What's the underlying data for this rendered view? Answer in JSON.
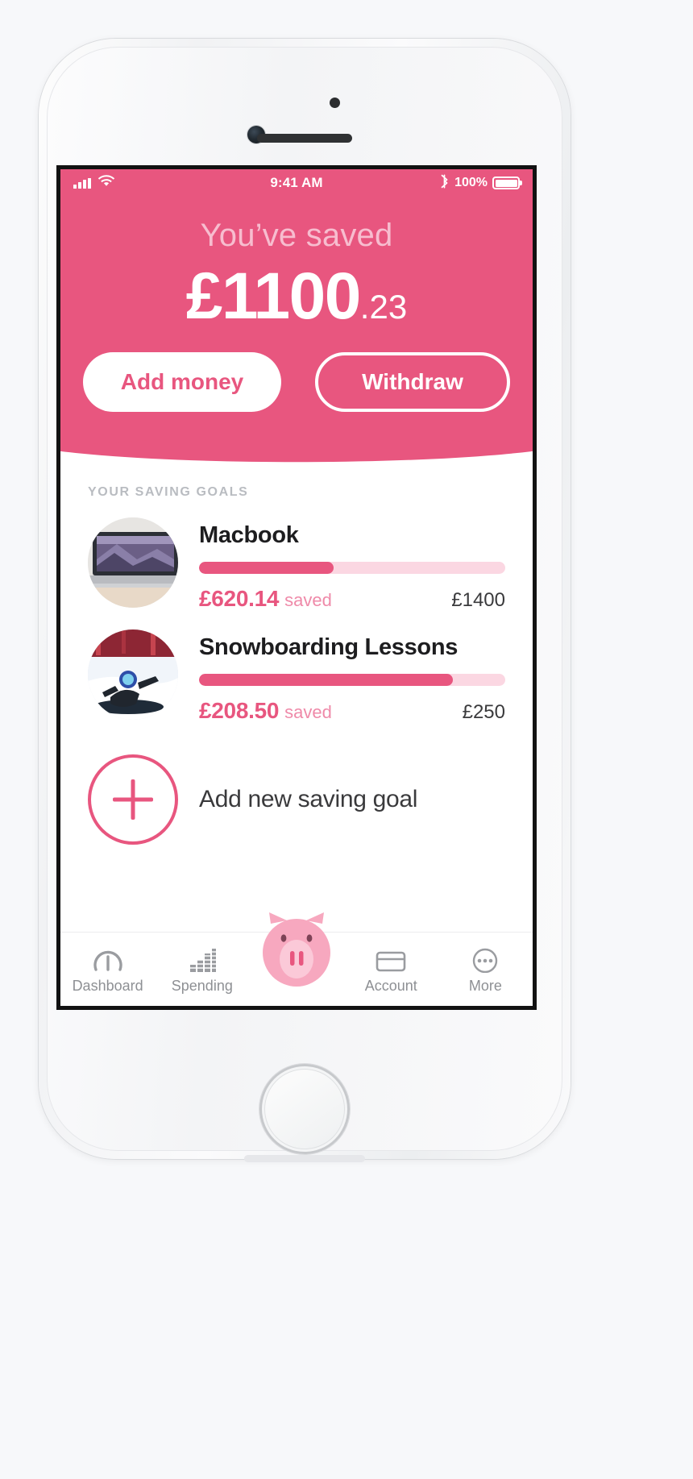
{
  "statusbar": {
    "signal_icon": "cellular-signal-icon",
    "wifi_icon": "wifi-icon",
    "time": "9:41 AM",
    "bluetooth_icon": "bluetooth-icon",
    "battery_percent": "100%",
    "battery_icon": "battery-full-icon",
    "battery_level": 100
  },
  "hero": {
    "accent_color": "#e8567f",
    "label": "You’ve saved",
    "amount_major": "£1100",
    "amount_cents": ".23",
    "add_money_label": "Add money",
    "withdraw_label": "Withdraw"
  },
  "goals": {
    "section_title": "YOUR SAVING GOALS",
    "saved_word": "saved",
    "items": [
      {
        "name": "Macbook",
        "thumb_icon": "macbook-photo",
        "saved": "£620.14",
        "target": "£1400",
        "progress_percent": 44
      },
      {
        "name": "Snowboarding Lessons",
        "thumb_icon": "snowboarder-photo",
        "saved": "£208.50",
        "target": "£250",
        "progress_percent": 83
      }
    ],
    "add_goal": {
      "label": "Add new saving goal",
      "icon": "plus-circle-icon"
    }
  },
  "tabbar": {
    "items": [
      {
        "label": "Dashboard",
        "icon": "gauge-icon"
      },
      {
        "label": "Spending",
        "icon": "bar-chart-icon"
      },
      {
        "label": "Account",
        "icon": "card-icon"
      },
      {
        "label": "More",
        "icon": "ellipsis-circle-icon"
      }
    ],
    "fab": {
      "icon": "piggy-bank-icon",
      "color": "#f7a8bf"
    }
  }
}
